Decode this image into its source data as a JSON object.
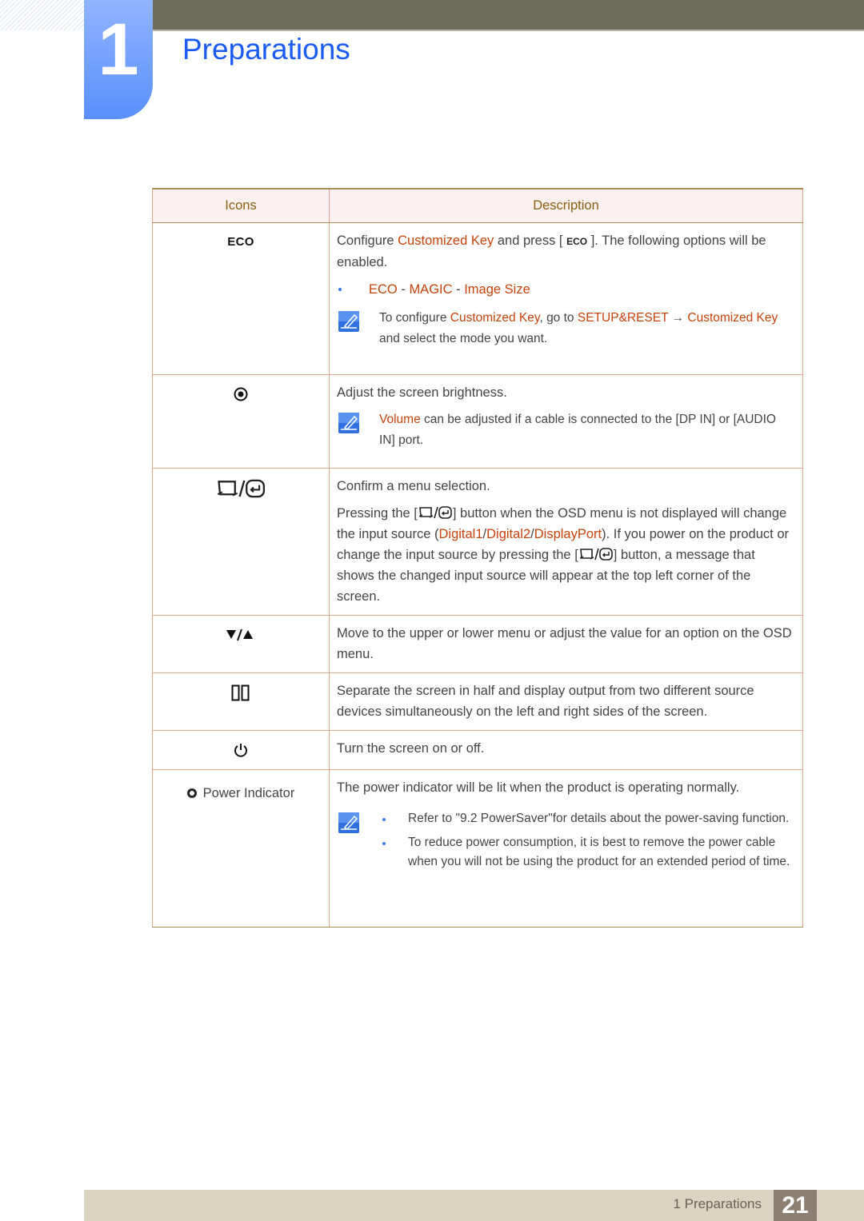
{
  "header": {
    "chapter_number": "1",
    "title": "Preparations"
  },
  "table": {
    "columns": [
      "Icons",
      "Description"
    ],
    "rows": [
      {
        "icon": "eco-icon",
        "icon_label": "ECO",
        "desc": {
          "t1": "Configure ",
          "h1": "Customized Key",
          "t2": " and press [ ",
          "key": "ECO",
          "t3": " ]. The following options will be enabled."
        },
        "options": {
          "o1": "ECO",
          "sep1": " - ",
          "o2": "MAGIC",
          "sep2": " - ",
          "o3": "Image Size"
        },
        "note": {
          "t1": "To configure ",
          "h1": "Customized Key",
          "t2": ", go to ",
          "h2": "SETUP&RESET",
          "t3": " → ",
          "h3": "Customized Key",
          "t4": " and select the mode you want."
        }
      },
      {
        "icon": "brightness-icon",
        "desc": "Adjust the screen brightness.",
        "note": {
          "h1": "Volume",
          "t1": " can be adjusted if a cable is connected to the [DP IN] or [AUDIO IN] port."
        }
      },
      {
        "icon": "source-enter-icon",
        "desc1": "Confirm a menu selection.",
        "desc2": {
          "t1": "Pressing the [",
          "t2": "] button when the OSD menu is not displayed will change the input source (",
          "h1": "Digital1",
          "s1": "/",
          "h2": "Digital2",
          "s2": "/",
          "h3": "DisplayPort",
          "t3": "). If you power on the product or change the input source by pressing the [",
          "t4": "] button, a message that shows the changed input source will appear at the top left corner of the screen."
        }
      },
      {
        "icon": "down-up-arrows-icon",
        "desc": "Move to the upper or lower menu or adjust the value for an option on the OSD menu."
      },
      {
        "icon": "split-screen-icon",
        "desc": "Separate the screen in half and display output from two different source devices simultaneously on the left and right sides of the screen."
      },
      {
        "icon": "power-icon",
        "desc": "Turn the screen on or off."
      },
      {
        "icon": "power-indicator-icon",
        "icon_label": "Power Indicator",
        "desc": "The power indicator will be lit when the product is operating normally.",
        "notes": [
          "Refer to \"9.2 PowerSaver\"for details about the power-saving function.",
          "To reduce power consumption, it is best to remove the power cable when you will not be using the product for an extended period of time."
        ]
      }
    ]
  },
  "footer": {
    "section": "1 Preparations",
    "page_number": "21"
  },
  "colors": {
    "title_blue": "#1b5bf5",
    "highlight_orange": "#c8420c",
    "table_border": "#e8a48c",
    "header_text": "#8c5e10"
  }
}
